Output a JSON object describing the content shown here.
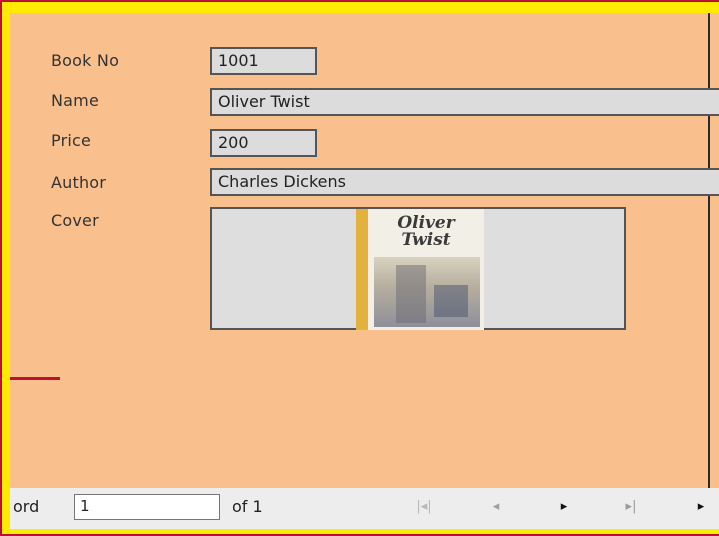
{
  "form": {
    "book_no": {
      "label": "Book No",
      "value": "1001"
    },
    "name": {
      "label": "Name",
      "value": "Oliver Twist"
    },
    "price": {
      "label": "Price",
      "value": "200"
    },
    "author": {
      "label": "Author",
      "value": "Charles Dickens"
    },
    "cover": {
      "label": "Cover",
      "book_title_line1": "Oliver",
      "book_title_line2": "Twist"
    }
  },
  "navigation": {
    "record_label": "ord",
    "record_value": "1",
    "of_label": "of 1",
    "first_icon": "first-record-icon",
    "prev_icon": "previous-record-icon",
    "next_icon": "next-record-icon",
    "last_icon": "last-record-icon",
    "new_icon": "new-record-icon"
  },
  "colors": {
    "background": "#f9c08e",
    "frame_yellow": "#ffea00",
    "frame_red": "#b80f3c",
    "field_bg": "#dcdcdc"
  }
}
